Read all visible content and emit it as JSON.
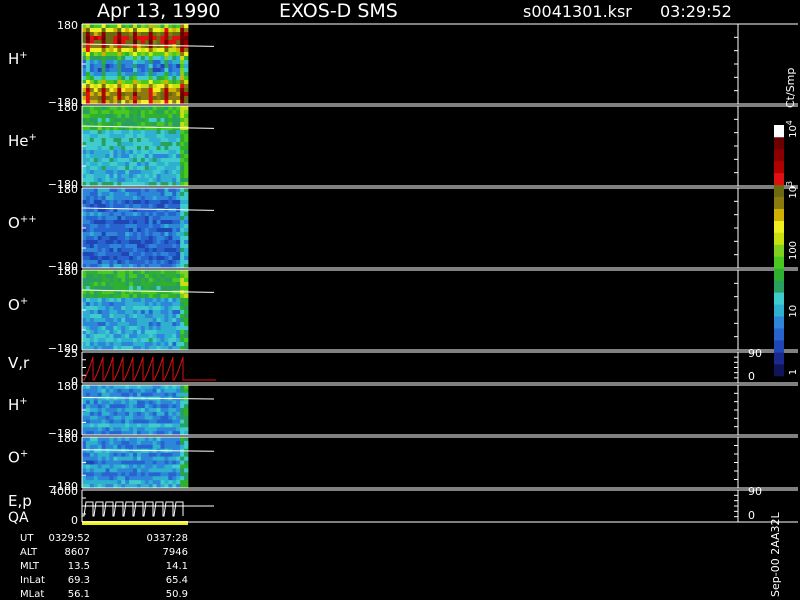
{
  "header": {
    "date": "Apr 13, 1990",
    "mission": "EXOS-D SMS",
    "file": "s0041301.ksr",
    "time": "03:29:52"
  },
  "colorbar": {
    "title": "Ct/Smp",
    "ticks": [
      "1",
      "10",
      "100",
      "10",
      "10"
    ],
    "tick_exponents": [
      "",
      "",
      "",
      "3",
      "4"
    ],
    "tick_values": [
      1,
      10,
      100,
      1000,
      10000
    ],
    "colors": [
      "#10145a",
      "#1a2a8c",
      "#1e46b4",
      "#2864d0",
      "#2e86d8",
      "#30b0d0",
      "#40cccc",
      "#2aa060",
      "#30b030",
      "#48c820",
      "#80d020",
      "#c8e010",
      "#f0f020",
      "#d0b000",
      "#8a7a10",
      "#6a6a10",
      "#e01010",
      "#b00000",
      "#8a0000",
      "#6a0000",
      "#ffffff"
    ]
  },
  "footer": {
    "rows": [
      {
        "label": "UT",
        "v1": "0329:52",
        "v2": "0337:28"
      },
      {
        "label": "ALT",
        "v1": "8607",
        "v2": "7946"
      },
      {
        "label": "MLT",
        "v1": "13.5",
        "v2": "14.1"
      },
      {
        "label": "InLat",
        "v1": "69.3",
        "v2": "65.4"
      },
      {
        "label": "MLat",
        "v1": "56.1",
        "v2": "50.9"
      }
    ],
    "version": "Sep-00 2AA32L"
  },
  "chart_data": {
    "type": "heatmap",
    "panels": [
      {
        "id": "h1",
        "label": "H",
        "sup": "+",
        "ytop": "180",
        "ybot": "−180",
        "ylim": [
          -180,
          180
        ],
        "profile": "h"
      },
      {
        "id": "he1",
        "label": "He",
        "sup": "+",
        "ytop": "180",
        "ybot": "−180",
        "ylim": [
          -180,
          180
        ],
        "profile": "he"
      },
      {
        "id": "o2",
        "label": "O",
        "sup": "++",
        "ytop": "180",
        "ybot": "−180",
        "ylim": [
          -180,
          180
        ],
        "profile": "opp"
      },
      {
        "id": "o1",
        "label": "O",
        "sup": "+",
        "ytop": "180",
        "ybot": "−180",
        "ylim": [
          -180,
          180
        ],
        "profile": "op"
      },
      {
        "id": "vr",
        "label": "V,r",
        "sup": "",
        "ytop": "25",
        "ybot": "0",
        "ylim": [
          0,
          25
        ],
        "right_top": "90",
        "right_bot": "0",
        "line": true
      },
      {
        "id": "h2",
        "label": "H",
        "sup": "+",
        "ytop": "180",
        "ybot": "−180",
        "ylim": [
          -180,
          180
        ],
        "profile": "h2"
      },
      {
        "id": "o3",
        "label": "O",
        "sup": "+",
        "ytop": "180",
        "ybot": "−180",
        "ylim": [
          -180,
          180
        ],
        "profile": "op2"
      },
      {
        "id": "ep",
        "label": "E,p",
        "sup": "",
        "ytop": "4000",
        "ybot": "0",
        "ylim": [
          0,
          4000
        ],
        "right_top": "90",
        "right_bot": "0",
        "line": true,
        "extra": "QA"
      }
    ]
  }
}
